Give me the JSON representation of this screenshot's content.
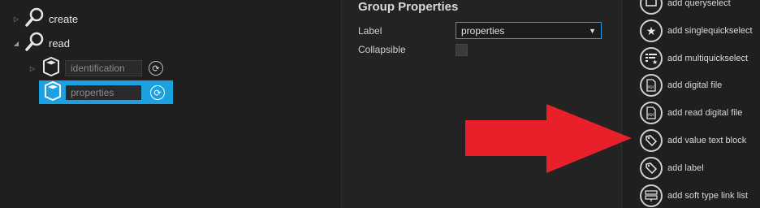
{
  "tree": {
    "create_label": "create",
    "read_label": "read",
    "identification_value": "identification",
    "properties_value": "properties",
    "refresh_glyph": "⟳"
  },
  "props": {
    "title": "Group Properties",
    "label_caption": "Label",
    "label_value": "properties",
    "collapsible_caption": "Collapsible"
  },
  "palette": {
    "items": [
      {
        "label": "add queryselect",
        "icon": "queryselect-icon"
      },
      {
        "label": "add singlequickselect",
        "icon": "star-icon"
      },
      {
        "label": "add multiquickselect",
        "icon": "list-star-icon"
      },
      {
        "label": "add digital file",
        "icon": "pdf-file-icon"
      },
      {
        "label": "add read digital file",
        "icon": "pdf-file-icon"
      },
      {
        "label": "add value text block",
        "icon": "tag-icon"
      },
      {
        "label": "add label",
        "icon": "tag-icon"
      },
      {
        "label": "add soft type link list",
        "icon": "link-list-icon"
      }
    ]
  },
  "colors": {
    "accent": "#1ba1e2",
    "arrow": "#e8202a"
  }
}
